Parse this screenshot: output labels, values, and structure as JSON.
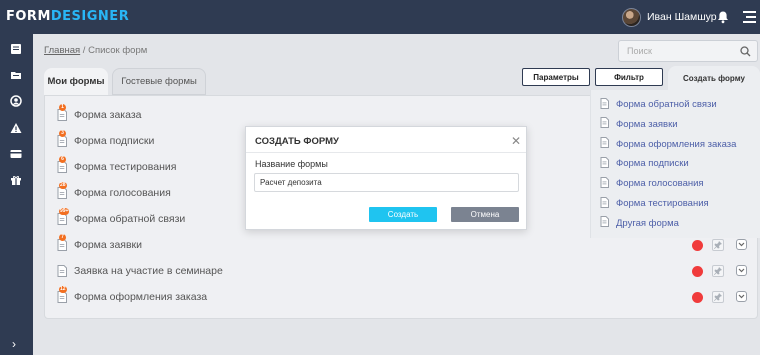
{
  "app": {
    "logo_part1": "FORM",
    "logo_part2": "DESIGNER",
    "user_name": "Иван Шамшур"
  },
  "colors": {
    "brand": "#2f3b52",
    "accent": "#29b6f6",
    "badge": "#f26f21",
    "status_red": "#f03b3b",
    "create_button": "#1fc4f0",
    "cancel_button": "#7b8391"
  },
  "sidebar": {
    "icons": [
      "list-icon",
      "folder-icon",
      "user-icon",
      "warning-icon",
      "card-icon",
      "gift-icon"
    ],
    "expand_icon": "chevron-right-icon"
  },
  "breadcrumb": {
    "home": "Главная",
    "separator": " / ",
    "current": "Список форм"
  },
  "search": {
    "placeholder": "Поиск"
  },
  "tabs": {
    "active": "Мои формы",
    "inactive": "Гостевые формы"
  },
  "toolbar": {
    "params": "Параметры",
    "filter": "Фильтр",
    "create": "Создать форму"
  },
  "forms": [
    {
      "label": "Форма заказа",
      "badge": "1"
    },
    {
      "label": "Форма подписки",
      "badge": "3"
    },
    {
      "label": "Форма тестирования",
      "badge": "6"
    },
    {
      "label": "Форма голосования",
      "badge": "28"
    },
    {
      "label": "Форма обратной связи",
      "badge": "99+"
    },
    {
      "label": "Форма заявки",
      "badge": "7"
    },
    {
      "label": "Заявка на участие в семинаре",
      "badge": ""
    },
    {
      "label": "Форма оформления заказа",
      "badge": "12"
    }
  ],
  "create_menu": [
    "Форма обратной связи",
    "Форма заявки",
    "Форма оформления заказа",
    "Форма подписки",
    "Форма голосования",
    "Форма тестирования",
    "Другая форма"
  ],
  "modal": {
    "title": "СОЗДАТЬ ФОРМУ",
    "field_label": "Название формы",
    "field_value": "Расчет депозита",
    "create": "Создать",
    "cancel": "Отмена"
  }
}
